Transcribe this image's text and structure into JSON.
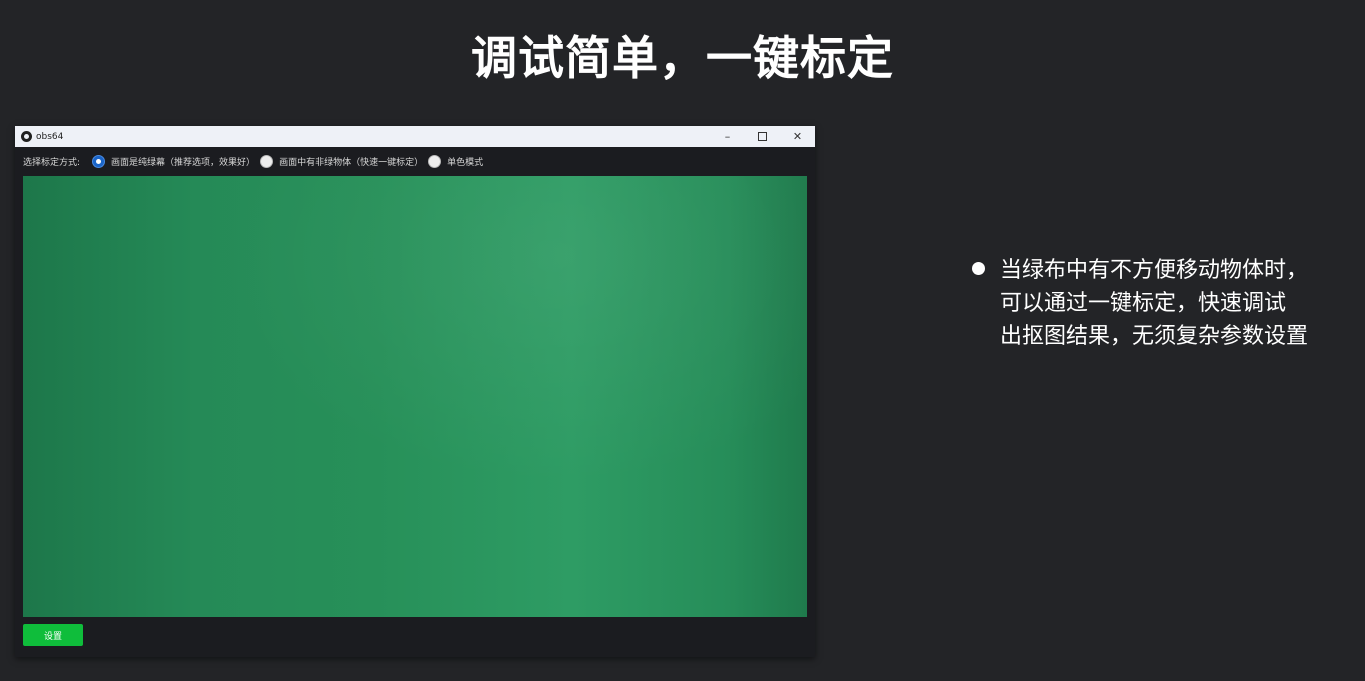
{
  "slide": {
    "title": "调试简单，一键标定"
  },
  "app": {
    "window_title": "obs64",
    "controls": {
      "minimize": "–",
      "close": "✕"
    },
    "calibration": {
      "label": "选择标定方式:",
      "options": [
        {
          "label": "画面是纯绿幕（推荐选项，效果好）",
          "checked": true
        },
        {
          "label": "画面中有非绿物体（快速一键标定）",
          "checked": false
        },
        {
          "label": "单色模式",
          "checked": false
        }
      ]
    },
    "settings_button": "设置"
  },
  "bullet": {
    "lines": [
      "当绿布中有不方便移动物体时，",
      "可以通过一键标定，快速调试",
      "出抠图结果，无须复杂参数设置"
    ]
  },
  "colors": {
    "background": "#232427",
    "green_screen": "#279059",
    "settings_button": "#0fbd3b",
    "radio_selected": "#1a64c8"
  }
}
